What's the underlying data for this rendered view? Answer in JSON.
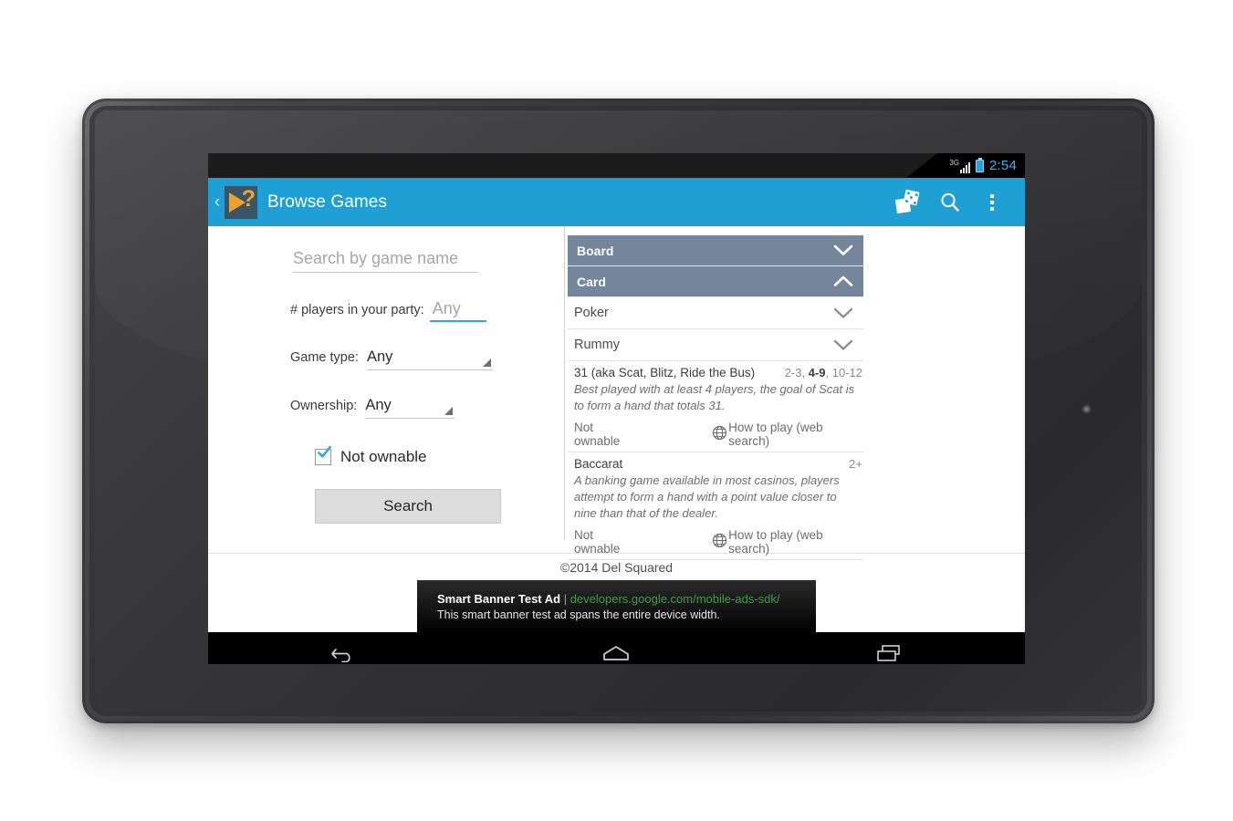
{
  "status_bar": {
    "network": "3G",
    "clock": "2:54",
    "battery_icon": "battery-icon",
    "signal_icon": "signal-bars-icon"
  },
  "action_bar": {
    "back_chevron": "‹",
    "logo_icon": "app-logo-play-question-icon",
    "logo_question_mark": "?",
    "title": "Browse Games",
    "icons": [
      {
        "name": "dice-icon",
        "label": "Dice"
      },
      {
        "name": "search-icon",
        "label": "Search"
      },
      {
        "name": "overflow-menu-icon",
        "label": "More options"
      }
    ],
    "accent_color": "#1fa0d4"
  },
  "search_form": {
    "name_placeholder": "Search by game name",
    "name_value": "",
    "players_label": "# players in your party:",
    "players_value": "Any",
    "game_type_label": "Game type:",
    "game_type_value": "Any",
    "ownership_label": "Ownership:",
    "ownership_value": "Any",
    "not_ownable_label": "Not ownable",
    "not_ownable_checked": true,
    "search_button": "Search",
    "focus_color": "#2fa8dd"
  },
  "results": {
    "header_color": "#75859b",
    "categories": [
      {
        "label": "Board",
        "expanded": false,
        "chevron": "chevron-down-icon"
      },
      {
        "label": "Card",
        "expanded": true,
        "chevron": "chevron-up-icon"
      }
    ],
    "subcategories": [
      {
        "label": "Poker",
        "chevron": "chevron-down-icon"
      },
      {
        "label": "Rummy",
        "chevron": "chevron-down-icon"
      }
    ],
    "games": [
      {
        "title": "31 (aka Scat, Blitz, Ride the Bus)",
        "players_parts": [
          {
            "text": "2-3",
            "bold": false
          },
          {
            "text": ", ",
            "bold": false
          },
          {
            "text": "4-9",
            "bold": true
          },
          {
            "text": ", ",
            "bold": false
          },
          {
            "text": "10-12",
            "bold": false
          }
        ],
        "players_plain": "2-3, 4-9, 10-12",
        "description": "Best played with at least 4 players, the goal of Scat is to form a hand that totals 31.",
        "ownership": "Not ownable",
        "web_link": "How to play (web search)",
        "web_icon": "globe-icon"
      },
      {
        "title": "Baccarat",
        "players_parts": [
          {
            "text": "2+",
            "bold": false
          }
        ],
        "players_plain": "2+",
        "description": "A banking game available in most casinos, players attempt to form a hand with a point value closer to nine than that of the dealer.",
        "ownership": "Not ownable",
        "web_link": "How to play (web search)",
        "web_icon": "globe-icon"
      }
    ]
  },
  "footer": {
    "copyright": "©2014 Del Squared"
  },
  "ad_banner": {
    "title": "Smart Banner Test Ad",
    "separator": " | ",
    "url": "developers.google.com/mobile-ads-sdk/",
    "body": "This smart banner test ad spans the entire device width.",
    "url_color": "#3f9a4a"
  },
  "nav_bar": {
    "buttons": [
      {
        "name": "nav-back-button",
        "label": "Back"
      },
      {
        "name": "nav-home-button",
        "label": "Home"
      },
      {
        "name": "nav-recents-button",
        "label": "Recent apps"
      }
    ]
  }
}
